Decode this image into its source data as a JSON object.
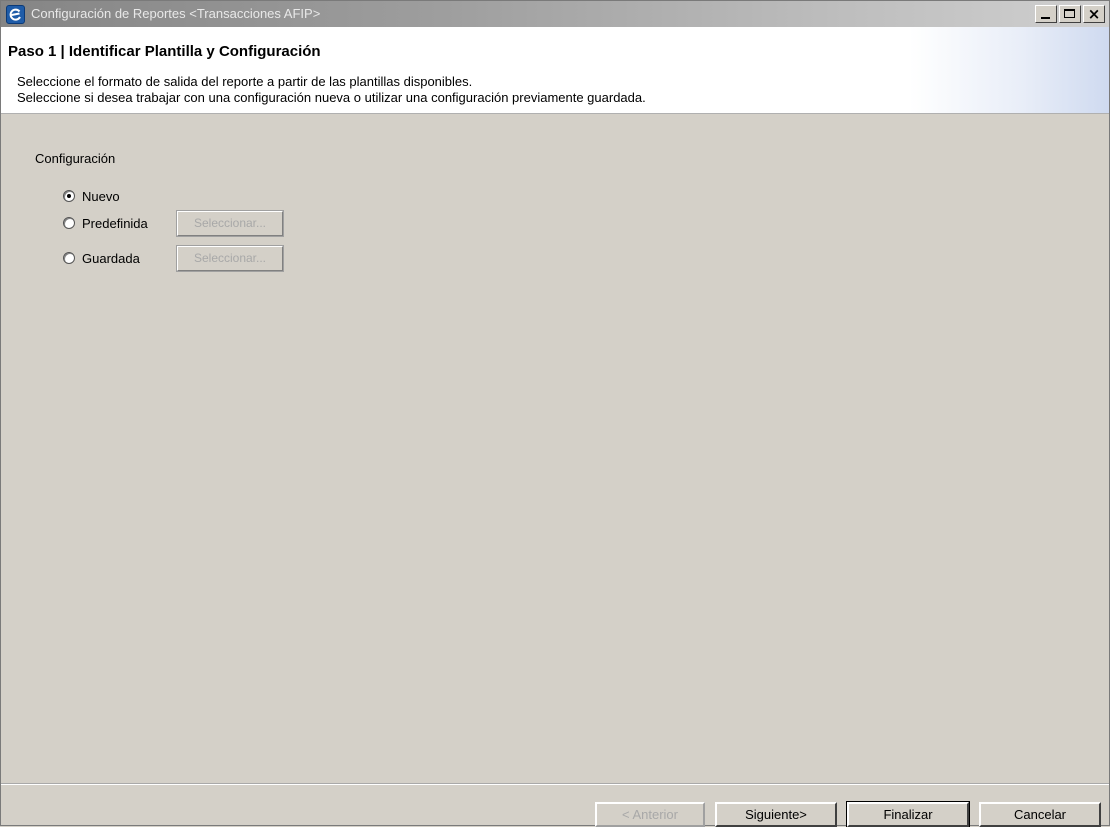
{
  "window": {
    "title": "Configuración de Reportes <Transacciones AFIP>",
    "controls": {
      "minimize": "_",
      "maximize": "□",
      "close": "×"
    }
  },
  "header": {
    "step_title": "Paso 1 | Identificar Plantilla y Configuración",
    "description_lines": [
      "Seleccione el formato de salida del reporte a partir de las plantillas disponibles.",
      "Seleccione si desea trabajar con una configuración nueva o utilizar una configuración previamente guardada."
    ]
  },
  "configuration": {
    "section_label": "Configuración",
    "options": [
      {
        "label": "Nuevo",
        "checked": true
      },
      {
        "label": "Predefinida",
        "checked": false,
        "button": "Seleccionar..."
      },
      {
        "label": "Guardada",
        "checked": false,
        "button": "Seleccionar..."
      }
    ]
  },
  "footer": {
    "previous": "< Anterior",
    "next": "Siguiente>",
    "finish": "Finalizar",
    "cancel": "Cancelar"
  },
  "icons": {
    "app": "app-logo-icon",
    "minimize": "minimize-icon",
    "maximize": "maximize-icon",
    "close": "close-icon"
  },
  "colors": {
    "background": "#d4d0c8",
    "title_text": "#e8e8e8",
    "disabled_text": "#a8a8a8"
  }
}
